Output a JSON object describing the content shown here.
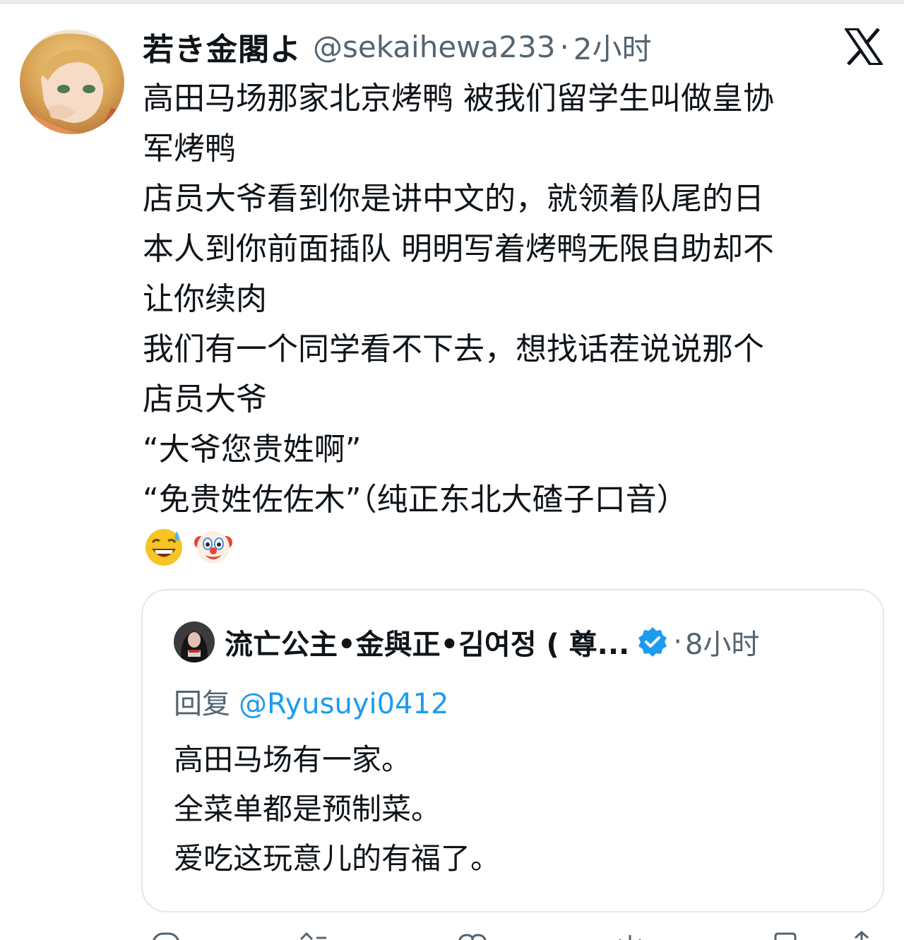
{
  "tweet": {
    "display_name": "若き金閣よ",
    "handle": "@sekaihewa233",
    "separator": "·",
    "time": "2小时",
    "lines": [
      "高田马场那家北京烤鸭 被我们留学生叫做皇协",
      "军烤鸭",
      "店员大爷看到你是讲中文的，就领着队尾的日",
      "本人到你前面插队 明明写着烤鸭无限自助却不",
      "让你续肉",
      "我们有一个同学看不下去，想找话茬说说那个",
      "店员大爷",
      "“大爷您贵姓啊”",
      "“免贵姓佐佐木”（纯正东北大碴子口音）"
    ],
    "emojis": [
      "grinning-sweat-emoji",
      "clown-face-emoji"
    ]
  },
  "quoted_tweet": {
    "display_name": "流亡公主•金與正•김여정 ( 尊...",
    "separator": "·",
    "time": "8小时",
    "reply_prefix": "回复",
    "reply_to": "@Ryusuyi0412",
    "lines": [
      "高田马场有一家。",
      "全菜单都是预制菜。",
      "爱吃这玩意儿的有福了。"
    ]
  },
  "icons": {
    "platform_logo": "x-logo-icon",
    "verified": "verified-badge-icon",
    "actions": [
      "reply-icon",
      "retweet-icon",
      "like-icon",
      "views-icon",
      "bookmark-icon",
      "share-icon"
    ]
  },
  "colors": {
    "text_primary": "#0f1419",
    "text_secondary": "#536471",
    "link": "#1d9bf0",
    "border": "#e4e8eb"
  }
}
